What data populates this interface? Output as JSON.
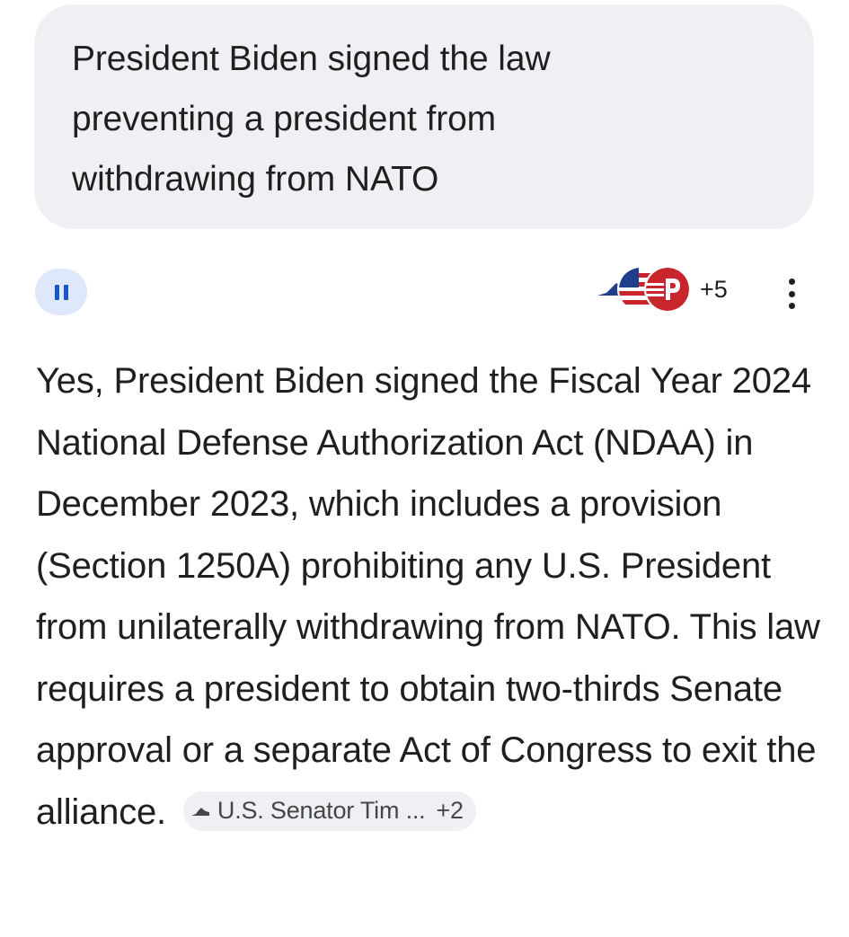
{
  "user_message": {
    "text": "President Biden signed the law preventing a president from withdrawing from NATO"
  },
  "response_header": {
    "pause_icon": "pause-icon",
    "sources": [
      {
        "icon": "virginia-state-icon"
      },
      {
        "icon": "flag-stripes-icon"
      },
      {
        "icon": "red-p-logo-icon"
      }
    ],
    "sources_more_count": "+5",
    "more_icon": "more-vert-icon"
  },
  "answer": {
    "text": "Yes, President Biden signed the Fiscal Year 2024 National Defense Authorization Act (NDAA) in December 2023, which includes a provision (Section 1250A) prohibiting any U.S. President from unilaterally withdrawing from NATO. This law requires a president to obtain two-thirds Senate approval or a separate Act of Congress to exit the alliance.",
    "citation": {
      "icon": "virginia-state-icon",
      "label": "U.S. Senator Tim ...",
      "count": "+2"
    }
  },
  "colors": {
    "bubble_bg": "#eef0f4",
    "pause_bg": "#dfe7fb",
    "pause_accent": "#1a57c9",
    "text": "#1f1f1f",
    "flag_red": "#c8262c",
    "flag_blue": "#1f3f8c"
  }
}
